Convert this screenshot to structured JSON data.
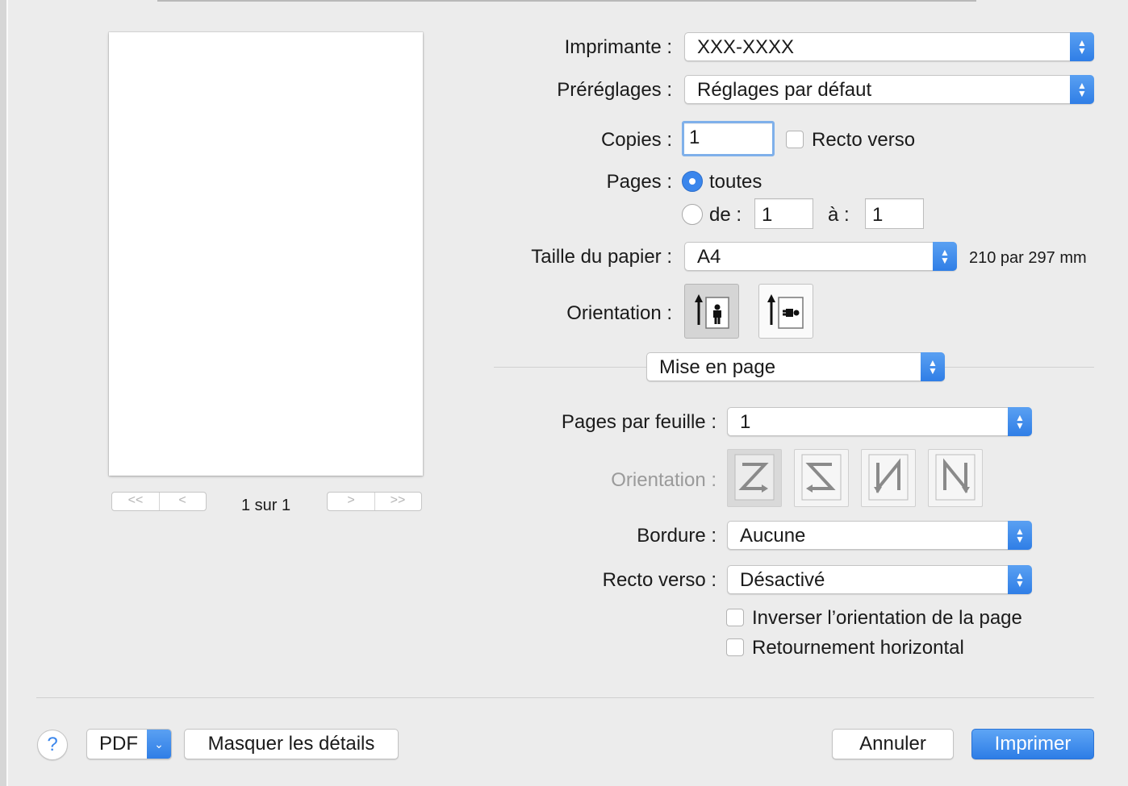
{
  "preview": {
    "page_indicator": "1 sur 1",
    "nav_first": "<<",
    "nav_prev": "<",
    "nav_next": ">",
    "nav_last": ">>"
  },
  "printer": {
    "label": "Imprimante :",
    "value": "XXX-XXXX"
  },
  "presets": {
    "label": "Préréglages :",
    "value": "Réglages par défaut"
  },
  "copies": {
    "label": "Copies :",
    "value": "1",
    "duplex_label": "Recto verso",
    "duplex_checked": false
  },
  "pages": {
    "label": "Pages :",
    "all_label": "toutes",
    "all_selected": true,
    "from_label": "de :",
    "from_value": "1",
    "to_label": "à :",
    "to_value": "1"
  },
  "paper": {
    "label": "Taille du papier :",
    "value": "A4",
    "dimensions": "210 par 297 mm"
  },
  "orientation": {
    "label": "Orientation :",
    "options": [
      "portrait-icon",
      "landscape-icon"
    ],
    "selected": "portrait"
  },
  "section_menu": {
    "value": "Mise en page"
  },
  "layout": {
    "pages_per_sheet_label": "Pages par feuille :",
    "pages_per_sheet_value": "1",
    "layout_direction_label": "Orientation :",
    "layout_direction_icons": [
      "z-order-icon",
      "reverse-z-order-icon",
      "reverse-n-order-icon",
      "n-order-icon"
    ],
    "border_label": "Bordure :",
    "border_value": "Aucune",
    "two_sided_label": "Recto verso :",
    "two_sided_value": "Désactivé",
    "reverse_orientation_label": "Inverser l’orientation de la page",
    "reverse_orientation_checked": false,
    "flip_horizontal_label": "Retournement horizontal",
    "flip_horizontal_checked": false
  },
  "footer": {
    "help_label": "?",
    "pdf_label": "PDF",
    "hide_details_label": "Masquer les détails",
    "cancel_label": "Annuler",
    "print_label": "Imprimer"
  },
  "colors": {
    "accent": "#3a86ec",
    "background": "#ececec"
  }
}
